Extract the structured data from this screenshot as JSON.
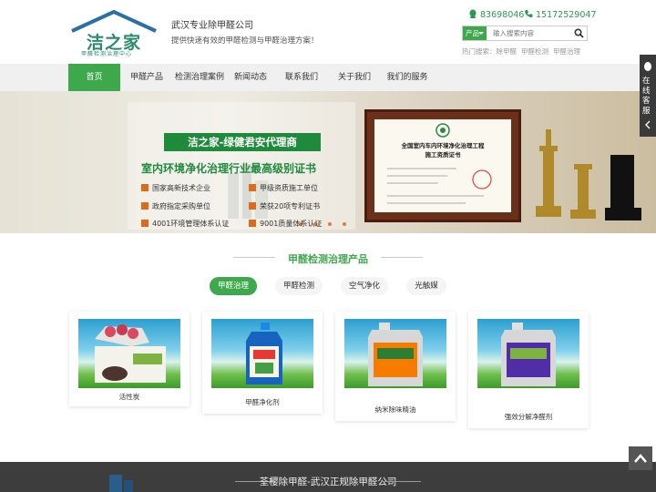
{
  "header": {
    "logo_text": "洁之家",
    "logo_sub": "甲醛检测治理中心",
    "company": "武汉专业除甲醛公司",
    "slogan": "提供快速有效的甲醛检测与甲醛治理方案！",
    "qq": "83698046",
    "phone": "15172529047",
    "search_type": "产品",
    "search_placeholder": "输入搜索内容",
    "hot_label": "热门搜索：",
    "hot_items": [
      "除甲醛",
      "甲醛检测",
      "甲醛治理"
    ]
  },
  "nav": {
    "items": [
      "首页",
      "甲醛产品",
      "检测治理案例",
      "新闻动态",
      "联系我们",
      "关于我们",
      "我们的服务"
    ],
    "active": 0
  },
  "banner": {
    "title": "洁之家-绿健君安代理商",
    "subtitle": "室内环境净化治理行业最高级别证书",
    "features": [
      "国家高新技术企业",
      "甲级资质施工单位",
      "政府指定采购单位",
      "荣获20项专利证书",
      "4001环境管理体系认证",
      "9001质量体系认证"
    ],
    "certificate_title_1": "全国室内车内环境净化治理工程",
    "certificate_title_2": "施工资质证书"
  },
  "products": {
    "title": "甲醛检测治理产品",
    "tabs": [
      "甲醛治理",
      "甲醛检测",
      "空气净化",
      "光触媒"
    ],
    "active_tab": 0,
    "items": [
      {
        "name": "活性炭"
      },
      {
        "name": "甲醛净化剂"
      },
      {
        "name": "纳米除味精油"
      },
      {
        "name": "强效分解净醛剂"
      }
    ]
  },
  "footer": {
    "title": "荃樱除甲醛-武汉正规除甲醛公司"
  },
  "sidebar": {
    "label": "在线客服"
  },
  "colors": {
    "brand_green": "#3ea84c",
    "dark_green": "#1f8a3c",
    "accent_orange": "#e06a1b"
  },
  "icons": [
    "qq-icon",
    "phone-icon",
    "search-icon",
    "chevron-down-icon",
    "back-to-top-icon",
    "qq-chat-icon"
  ]
}
